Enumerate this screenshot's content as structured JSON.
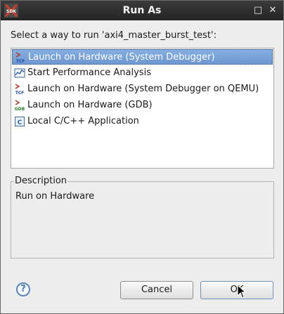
{
  "window": {
    "title": "Run As",
    "maximize_glyph": "□",
    "close_glyph": "✕"
  },
  "dialog": {
    "prompt": "Select a way to run 'axi4_master_burst_test':",
    "items": [
      {
        "label": "Launch on Hardware (System Debugger)",
        "icon": "tcf-launch-icon",
        "selected": true
      },
      {
        "label": "Start Performance Analysis",
        "icon": "performance-chart-icon",
        "selected": false
      },
      {
        "label": "Launch on Hardware (System Debugger on QEMU)",
        "icon": "tcf-launch-icon",
        "selected": false
      },
      {
        "label": "Launch on Hardware (GDB)",
        "icon": "gdb-launch-icon",
        "selected": false
      },
      {
        "label": "Local C/C++ Application",
        "icon": "c-application-icon",
        "selected": false
      }
    ],
    "description_label": "Description",
    "description_text": "Run on Hardware",
    "help_glyph": "?",
    "cancel_label": "Cancel",
    "ok_label": "OK"
  },
  "colors": {
    "titlebar": "#2e2e2e",
    "selection": "#7aa2d8",
    "dialog_bg": "#ededed"
  }
}
